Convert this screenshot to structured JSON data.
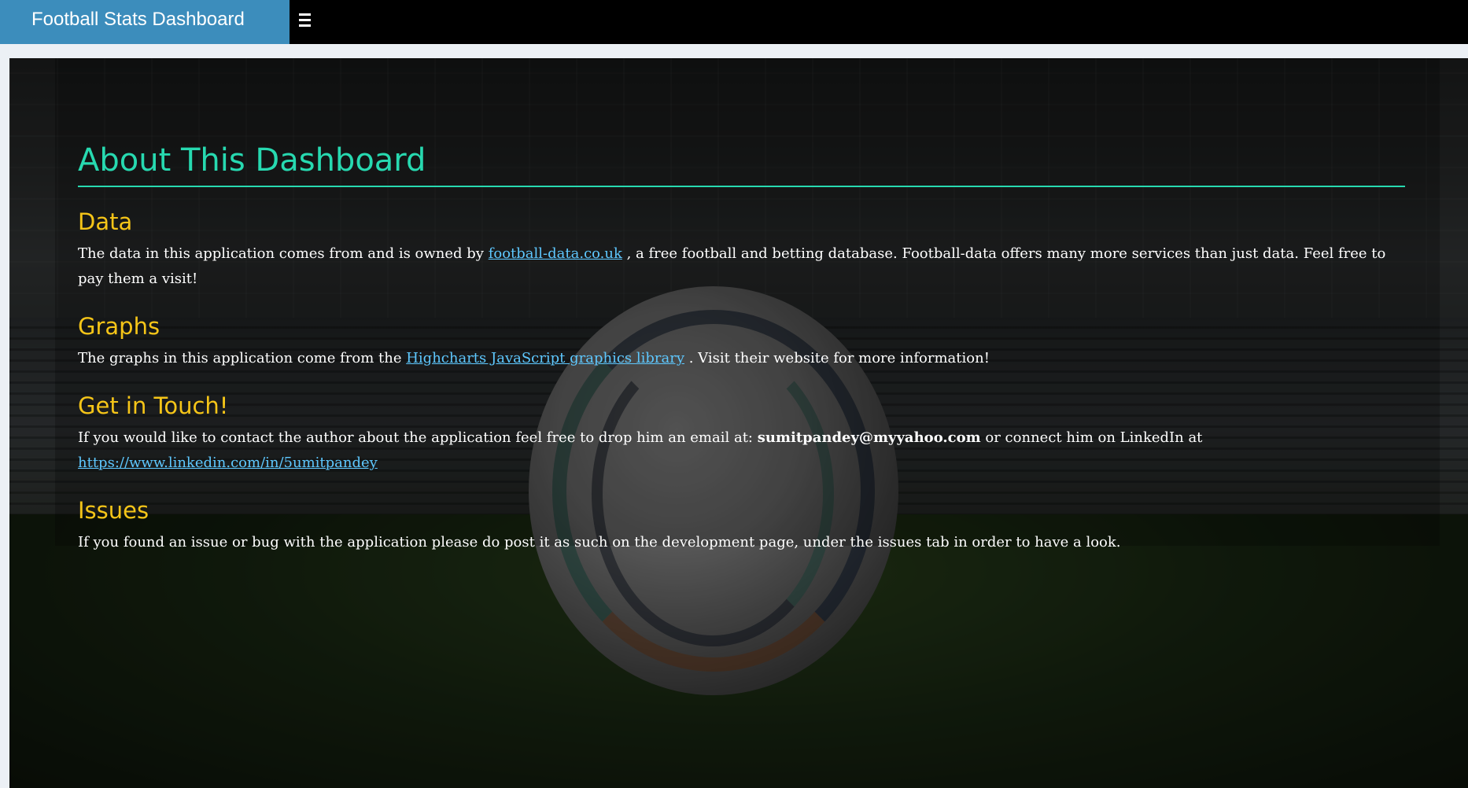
{
  "header": {
    "brand": "Football Stats Dashboard",
    "menu_icon": "hamburger-icon"
  },
  "main": {
    "title": "About This Dashboard",
    "sections": [
      {
        "heading": "Data",
        "text_before": "The data in this application comes from and is owned by ",
        "link": "football-data.co.uk",
        "text_after": " , a free football and betting database. Football-data offers many more services than just data. Feel free to pay them a visit!"
      },
      {
        "heading": "Graphs",
        "text_before": "The graphs in this application come from the ",
        "link": "Highcharts JavaScript graphics library",
        "text_after": " . Visit their website for more information!"
      },
      {
        "heading": "Get in Touch!",
        "text_before": "If you would like to contact the author about the application feel free to drop him an email at: ",
        "email": "sumitpandey@myyahoo.com",
        "text_middle": " or connect him on LinkedIn at ",
        "link": "https://www.linkedin.com/in/5umitpandey"
      },
      {
        "heading": "Issues",
        "text": "If you found an issue or bug with the application please do post it as such on the development page, under the issues tab in order to have a look."
      }
    ]
  },
  "colors": {
    "brand_bg": "#3c8dbc",
    "title": "#27d9b0",
    "heading": "#f5c518",
    "link": "#5ec8ff"
  }
}
